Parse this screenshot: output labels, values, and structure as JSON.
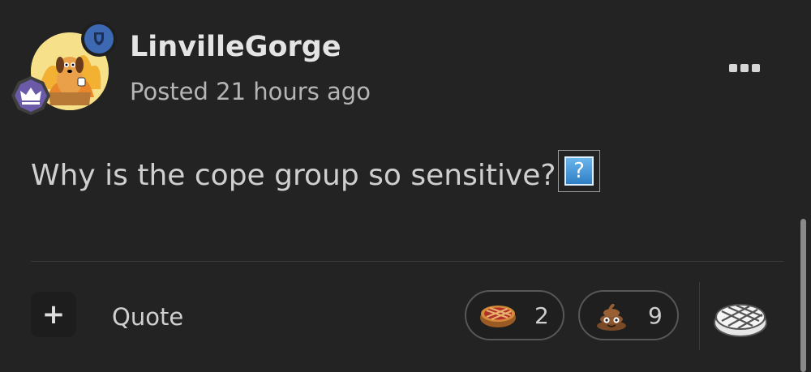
{
  "post": {
    "username": "LinvilleGorge",
    "posted": "Posted 21 hours ago",
    "body": "Why is the cope group so sensitive?",
    "emoji_inline": "?"
  },
  "actions": {
    "plus_label": "+",
    "quote_label": "Quote"
  },
  "reactions": [
    {
      "icon": "pie-icon",
      "count": "2"
    },
    {
      "icon": "poop-icon",
      "count": "9"
    }
  ],
  "colors": {
    "background": "#232323",
    "mod_badge": "#3d69b3",
    "rank_badge": "#6a5aa8"
  }
}
